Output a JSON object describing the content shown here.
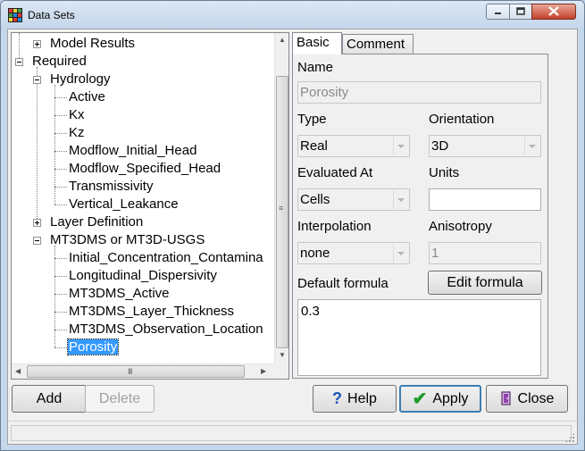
{
  "window": {
    "title": "Data Sets"
  },
  "tree": {
    "items": [
      {
        "label": "Model Results",
        "expander": "plus"
      },
      {
        "label": "Required",
        "expander": "minus"
      },
      {
        "label": "Hydrology",
        "expander": "minus"
      },
      {
        "label": "Active"
      },
      {
        "label": "Kx"
      },
      {
        "label": "Kz"
      },
      {
        "label": "Modflow_Initial_Head"
      },
      {
        "label": "Modflow_Specified_Head"
      },
      {
        "label": "Transmissivity"
      },
      {
        "label": "Vertical_Leakance"
      },
      {
        "label": "Layer Definition",
        "expander": "plus"
      },
      {
        "label": "MT3DMS or MT3D-USGS",
        "expander": "minus"
      },
      {
        "label": "Initial_Concentration_Contamina"
      },
      {
        "label": "Longitudinal_Dispersivity"
      },
      {
        "label": "MT3DMS_Active"
      },
      {
        "label": "MT3DMS_Layer_Thickness"
      },
      {
        "label": "MT3DMS_Observation_Location"
      },
      {
        "label": "Porosity",
        "selected": true
      }
    ],
    "hscroll_grip": "III",
    "vscroll_grip": "≡"
  },
  "tabs": [
    {
      "label": "Basic",
      "active": true
    },
    {
      "label": "Comment",
      "active": false
    }
  ],
  "basic": {
    "name_label": "Name",
    "name_value": "Porosity",
    "type_label": "Type",
    "type_value": "Real",
    "orientation_label": "Orientation",
    "orientation_value": "3D",
    "evaluated_label": "Evaluated At",
    "evaluated_value": "Cells",
    "units_label": "Units",
    "units_value": "",
    "interpolation_label": "Interpolation",
    "interpolation_value": "none",
    "anisotropy_label": "Anisotropy",
    "anisotropy_value": "1",
    "default_formula_label": "Default formula",
    "edit_formula_label": "Edit formula",
    "formula_value": "0.3"
  },
  "buttons": {
    "add": "Add",
    "delete": "Delete",
    "help": "Help",
    "apply": "Apply",
    "close": "Close"
  },
  "colors": {
    "selection": "#3399ff",
    "apply_icon": "#1e9b2a",
    "help_icon": "#1a56b5"
  }
}
